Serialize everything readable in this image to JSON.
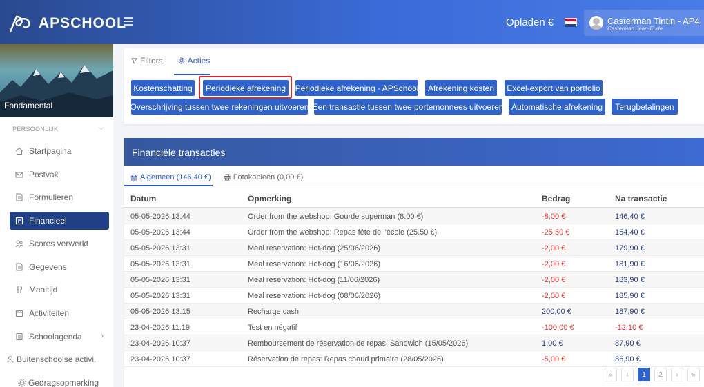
{
  "app": {
    "logo_text": "APSCHOOL"
  },
  "header": {
    "topup_label": "Opladen €",
    "user_name": "Casterman Tintin - AP4",
    "user_sub": "Casterman Jean-Eude"
  },
  "sidebar": {
    "banner_label": "Fondamental",
    "section_label": "PERSOONLIJK",
    "items": [
      {
        "label": "Startpagina",
        "icon": "home-icon"
      },
      {
        "label": "Postvak",
        "icon": "inbox-icon"
      },
      {
        "label": "Formulieren",
        "icon": "form-icon"
      },
      {
        "label": "Financieel",
        "icon": "finance-icon",
        "active": true
      },
      {
        "label": "Scores verwerkt",
        "icon": "scores-icon"
      },
      {
        "label": "Gegevens",
        "icon": "data-icon"
      },
      {
        "label": "Maaltijd",
        "icon": "meal-icon"
      },
      {
        "label": "Activiteiten",
        "icon": "calendar-icon"
      },
      {
        "label": "Schoolagenda",
        "icon": "agenda-icon"
      },
      {
        "label": "Buitenschoolse activi.",
        "icon": "people-icon"
      },
      {
        "label": "Gedragsopmerking",
        "icon": "gear-icon"
      }
    ]
  },
  "actions": {
    "tabs": [
      {
        "label": "Filters"
      },
      {
        "label": "Acties"
      }
    ],
    "buttons": [
      "Kostenschatting",
      "Periodieke afrekening",
      "Periodieke afrekening - APSchool",
      "Afrekening kosten",
      "Excel-export van portfolio",
      "Overschrijving tussen twee rekeningen uitvoeren",
      "Een transactie tussen twee portemonnees uitvoeren",
      "Automatische afrekening",
      "Terugbetalingen"
    ]
  },
  "transactions": {
    "title": "Financiële transacties",
    "subtabs": [
      {
        "label": "Algemeen (146,40 €)"
      },
      {
        "label": "Fotokopieën (0,00 €)"
      }
    ],
    "columns": [
      "Datum",
      "Opmerking",
      "Bedrag",
      "Na transactie"
    ],
    "rows": [
      {
        "date": "05-05-2026 13:44",
        "note": "Order from the webshop: Gourde superman (8.00 €)",
        "amount": "-8,00 €",
        "after": "146,40 €",
        "amount_neg": true,
        "after_neg": false
      },
      {
        "date": "05-05-2026 13:44",
        "note": "Order from the webshop: Repas fête de l'école (25.50 €)",
        "amount": "-25,50 €",
        "after": "154,40 €",
        "amount_neg": true,
        "after_neg": false
      },
      {
        "date": "05-05-2026 13:31",
        "note": "Meal reservation: Hot-dog (25/06/2026)",
        "amount": "-2,00 €",
        "after": "179,90 €",
        "amount_neg": true,
        "after_neg": false
      },
      {
        "date": "05-05-2026 13:31",
        "note": "Meal reservation: Hot-dog (16/06/2026)",
        "amount": "-2,00 €",
        "after": "181,90 €",
        "amount_neg": true,
        "after_neg": false
      },
      {
        "date": "05-05-2026 13:31",
        "note": "Meal reservation: Hot-dog (11/06/2026)",
        "amount": "-2,00 €",
        "after": "183,90 €",
        "amount_neg": true,
        "after_neg": false
      },
      {
        "date": "05-05-2026 13:31",
        "note": "Meal reservation: Hot-dog (08/06/2026)",
        "amount": "-2,00 €",
        "after": "185,90 €",
        "amount_neg": true,
        "after_neg": false
      },
      {
        "date": "05-05-2026 13:15",
        "note": "Recharge cash",
        "amount": "200,00 €",
        "after": "187,90 €",
        "amount_neg": false,
        "after_neg": false
      },
      {
        "date": "23-04-2026 11:19",
        "note": "Test en négatif",
        "amount": "-100,00 €",
        "after": "-12,10 €",
        "amount_neg": true,
        "after_neg": true
      },
      {
        "date": "23-04-2026 10:37",
        "note": "Remboursement de réservation de repas: Sandwich (15/05/2026)",
        "amount": "1,00 €",
        "after": "87,90 €",
        "amount_neg": false,
        "after_neg": false
      },
      {
        "date": "23-04-2026 10:37",
        "note": "Réservation de repas: Repas chaud primaire (28/05/2026)",
        "amount": "-5,00 €",
        "after": "86,90 €",
        "amount_neg": true,
        "after_neg": false
      }
    ]
  },
  "pagination": {
    "first": "«",
    "prev": "‹",
    "pages": [
      "1",
      "2"
    ],
    "current": "1",
    "next": "›",
    "last": "»"
  },
  "colors": {
    "primary": "#2f63c9",
    "active_nav": "#1f3f86",
    "negative": "#e53935",
    "highlight": "#d32f2f"
  }
}
